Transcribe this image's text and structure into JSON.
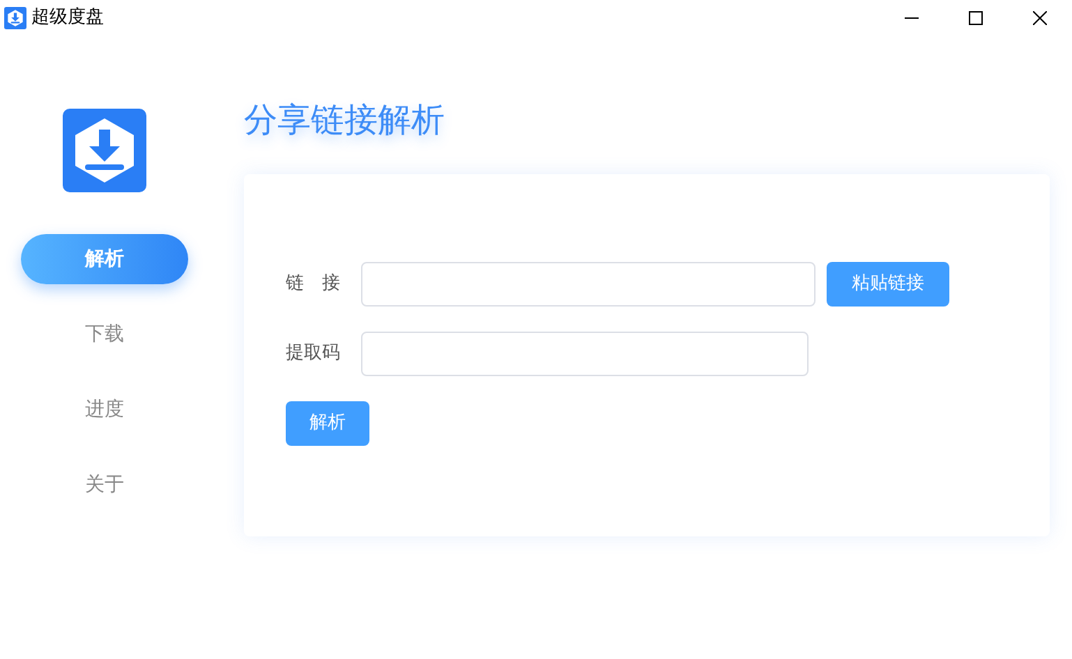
{
  "window": {
    "title": "超级度盘"
  },
  "sidebar": {
    "items": [
      {
        "label": "解析",
        "selected": true
      },
      {
        "label": "下载",
        "selected": false
      },
      {
        "label": "进度",
        "selected": false
      },
      {
        "label": "关于",
        "selected": false
      }
    ]
  },
  "page_title": "分享链接解析",
  "form": {
    "link_label": "链　接",
    "paste_button": "粘贴链接",
    "code_label": "提取码",
    "submit_button": "解析"
  }
}
